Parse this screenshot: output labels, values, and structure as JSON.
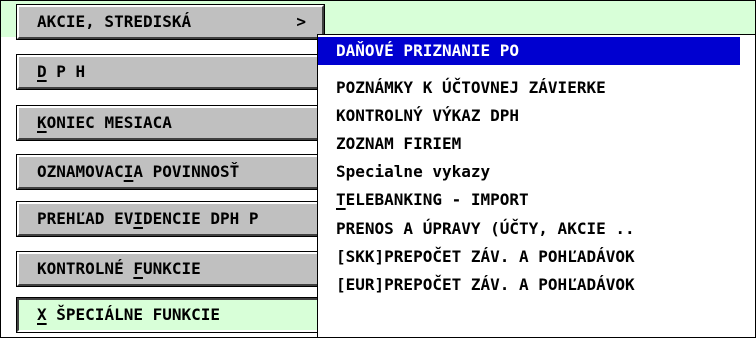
{
  "main_menu": {
    "items": [
      {
        "pre": "AKCIE, STREDISKÁ",
        "hot": "",
        "post": "",
        "arrow": ">"
      },
      {
        "pre": "",
        "hot": "D",
        "post": " P H",
        "arrow": ""
      },
      {
        "pre": "",
        "hot": "K",
        "post": "ONIEC MESIACA",
        "arrow": ""
      },
      {
        "pre": "OZNAMOVAC",
        "hot": "I",
        "post": "A POVINNOSŤ",
        "arrow": ""
      },
      {
        "pre": "PREHĽAD EV",
        "hot": "I",
        "post": "DENCIE DPH P",
        "arrow": ""
      },
      {
        "pre": "KONTROLNÉ ",
        "hot": "F",
        "post": "UNKCIE",
        "arrow": ""
      },
      {
        "pre": "",
        "hot": "X",
        "post": " ŠPECIÁLNE FUNKCIE",
        "arrow": ""
      }
    ]
  },
  "submenu": {
    "items": [
      {
        "pre": "DAŇOVÉ PRIZNANIE PO",
        "hot": "",
        "post": ""
      },
      {
        "pre": "POZNÁMKY K ÚČTOVNEJ ZÁVIERKE",
        "hot": "",
        "post": ""
      },
      {
        "pre": "KONTROLNÝ VÝKAZ DPH",
        "hot": "",
        "post": ""
      },
      {
        "pre": "ZOZNAM FIRIEM",
        "hot": "",
        "post": ""
      },
      {
        "pre": "Specialne vykazy",
        "hot": "",
        "post": ""
      },
      {
        "pre": "",
        "hot": "T",
        "post": "ELEBANKING - IMPORT"
      },
      {
        "pre": "PRENOS A ÚPRAVY (ÚČTY, AKCIE ..",
        "hot": "",
        "post": ""
      },
      {
        "pre": "[SKK]PREPOČET ZÁV. A POHĽADÁVOK",
        "hot": "",
        "post": ""
      },
      {
        "pre": "[EUR]PREPOČET ZÁV. A POHĽADÁVOK",
        "hot": "",
        "post": ""
      }
    ]
  },
  "colors": {
    "selected_bg": "#0000d0",
    "active_bg": "#d8ffd8",
    "button_bg": "#c0c0c0"
  }
}
